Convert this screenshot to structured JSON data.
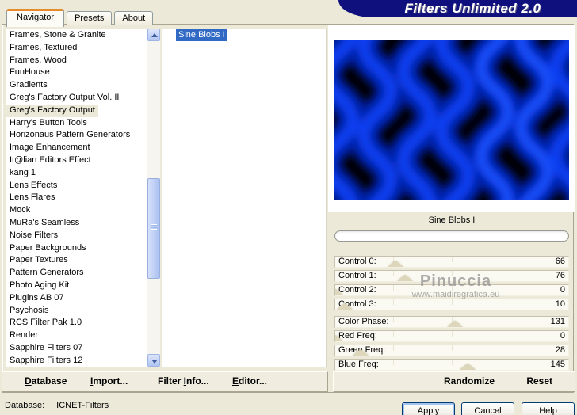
{
  "window": {
    "banner_title": "Filters Unlimited 2.0"
  },
  "tabs": [
    {
      "label": "Navigator",
      "active": true
    },
    {
      "label": "Presets",
      "active": false
    },
    {
      "label": "About",
      "active": false
    }
  ],
  "navigator": {
    "items": [
      "Frames, Stone & Granite",
      "Frames, Textured",
      "Frames, Wood",
      "FunHouse",
      "Gradients",
      "Greg's Factory Output Vol. II",
      "Greg's Factory Output",
      "Harry's Button Tools",
      "Horizonaus Pattern Generators",
      "Image Enhancement",
      "It@lian Editors Effect",
      "kang 1",
      "Lens Effects",
      "Lens Flares",
      "Mock",
      "MuRa's Seamless",
      "Noise Filters",
      "Paper Backgrounds",
      "Paper Textures",
      "Pattern Generators",
      "Photo Aging Kit",
      "Plugins AB 07",
      "Psychosis",
      "RCS Filter Pak 1.0",
      "Render",
      "Sapphire Filters 07",
      "Sapphire Filters 12"
    ],
    "selected": "Greg's Factory Output"
  },
  "filters": {
    "items": [
      "Sine Blobs I"
    ],
    "selected": "Sine Blobs I"
  },
  "preview": {
    "filter_name": "Sine Blobs I",
    "progress_percent": 0
  },
  "watermark": {
    "line1": "Pinuccia",
    "line2": "www.maidiregrafica.eu"
  },
  "sliders": [
    {
      "label": "Control 0:",
      "value": 66,
      "max": 255
    },
    {
      "label": "Control 1:",
      "value": 76,
      "max": 255
    },
    {
      "label": "Control 2:",
      "value": 0,
      "max": 255
    },
    {
      "label": "Control 3:",
      "value": 10,
      "max": 255
    },
    {
      "label": "Color Phase:",
      "value": 131,
      "max": 255
    },
    {
      "label": "Red Freq:",
      "value": 0,
      "max": 255
    },
    {
      "label": "Green Freq:",
      "value": 28,
      "max": 255
    },
    {
      "label": "Blue Freq:",
      "value": 145,
      "max": 255
    }
  ],
  "toolbar_left": {
    "database": {
      "pre": "",
      "u": "D",
      "post": "atabase"
    },
    "import": {
      "pre": "",
      "u": "I",
      "post": "mport..."
    },
    "filter_info": {
      "pre": "Filter ",
      "u": "I",
      "post": "nfo..."
    },
    "editor": {
      "pre": "",
      "u": "E",
      "post": "ditor..."
    }
  },
  "toolbar_right": {
    "randomize": "Randomize",
    "reset": "Reset"
  },
  "status_bar": {
    "label": "Database:",
    "value": "ICNET-Filters"
  },
  "dialog_buttons": {
    "apply": "Apply",
    "cancel": "Cancel",
    "help": "Help"
  },
  "colors": {
    "banner_navy": "#0f0f7d",
    "selection_blue": "#316ac5",
    "tab_accent_orange": "#e68b2c",
    "dialog_beige": "#ece9d8",
    "preview_blue_bright": "#0841f2",
    "preview_blue_dark": "#001f9e",
    "preview_black": "#000000"
  }
}
